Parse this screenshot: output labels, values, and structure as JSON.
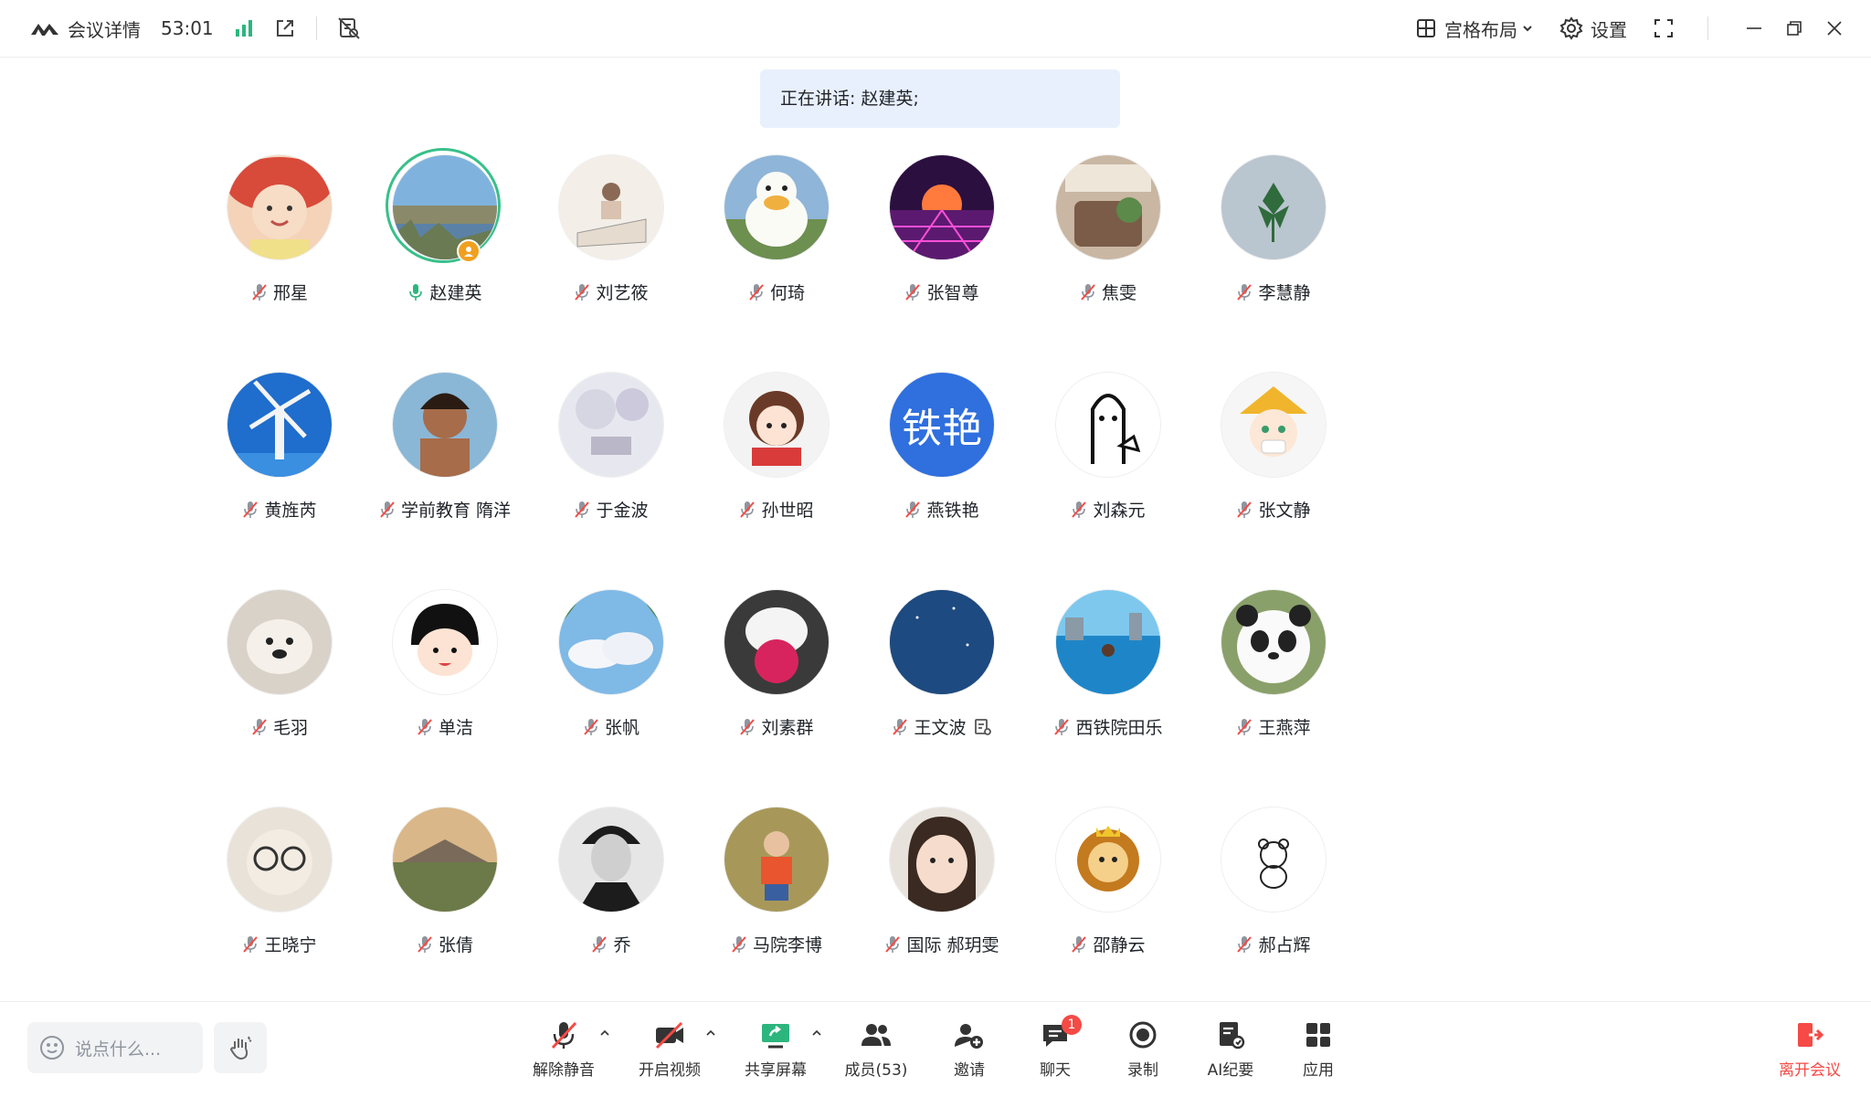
{
  "topbar": {
    "title": "会议详情",
    "timer": "53:01",
    "layout_label": "宫格布局",
    "settings_label": "设置"
  },
  "banner": {
    "text": "正在讲话: 赵建英;"
  },
  "participants": [
    {
      "name": "邢星",
      "avatar": "baby"
    },
    {
      "name": "赵建英",
      "avatar": "lake",
      "speaking": true,
      "host": true
    },
    {
      "name": "刘艺筱",
      "avatar": "sketch"
    },
    {
      "name": "何琦",
      "avatar": "duck"
    },
    {
      "name": "张智尊",
      "avatar": "synthwave"
    },
    {
      "name": "焦雯",
      "avatar": "cafe"
    },
    {
      "name": "李慧静",
      "avatar": "leaf"
    },
    {
      "name": "黄旌芮",
      "avatar": "windmill"
    },
    {
      "name": "学前教育 隋洋",
      "avatar": "man"
    },
    {
      "name": "于金波",
      "avatar": "winter"
    },
    {
      "name": "孙世昭",
      "avatar": "cartoon-girl"
    },
    {
      "name": "燕铁艳",
      "avatar_text": "铁艳"
    },
    {
      "name": "刘森元",
      "avatar": "doodle"
    },
    {
      "name": "张文静",
      "avatar": "jester"
    },
    {
      "name": "毛羽",
      "avatar": "dog"
    },
    {
      "name": "单洁",
      "avatar": "maruko"
    },
    {
      "name": "张帆",
      "avatar": "sky"
    },
    {
      "name": "刘素群",
      "avatar": "rabbit"
    },
    {
      "name": "王文波",
      "avatar": "night-sky",
      "extra_icon": "notes-icon"
    },
    {
      "name": "西铁院田乐",
      "avatar": "pool"
    },
    {
      "name": "王燕萍",
      "avatar": "panda"
    },
    {
      "name": "王晓宁",
      "avatar": "bear"
    },
    {
      "name": "张倩",
      "avatar": "camp"
    },
    {
      "name": "乔",
      "avatar": "bw-man"
    },
    {
      "name": "马院李博",
      "avatar": "kid"
    },
    {
      "name": "国际 郝玥雯",
      "avatar": "girl"
    },
    {
      "name": "邵静云",
      "avatar": "lion"
    },
    {
      "name": "郝占辉",
      "avatar": "teddy"
    }
  ],
  "bottombar": {
    "chat_placeholder": "说点什么...",
    "tools": [
      {
        "label": "解除静音",
        "icon": "mic-off-icon"
      },
      {
        "label": "开启视频",
        "icon": "camera-off-icon"
      },
      {
        "label": "共享屏幕",
        "icon": "share-screen-icon"
      },
      {
        "label": "成员(53)",
        "icon": "members-icon"
      },
      {
        "label": "邀请",
        "icon": "invite-icon"
      },
      {
        "label": "聊天",
        "icon": "chat-icon",
        "badge": "1"
      },
      {
        "label": "录制",
        "icon": "record-icon"
      },
      {
        "label": "AI纪要",
        "icon": "ai-notes-icon"
      },
      {
        "label": "应用",
        "icon": "apps-icon"
      }
    ],
    "leave_label": "离开会议"
  },
  "colors": {
    "accent": "#38c08a",
    "brand": "#2f6fde",
    "danger": "#f54a45",
    "banner": "#e9f0fd"
  }
}
